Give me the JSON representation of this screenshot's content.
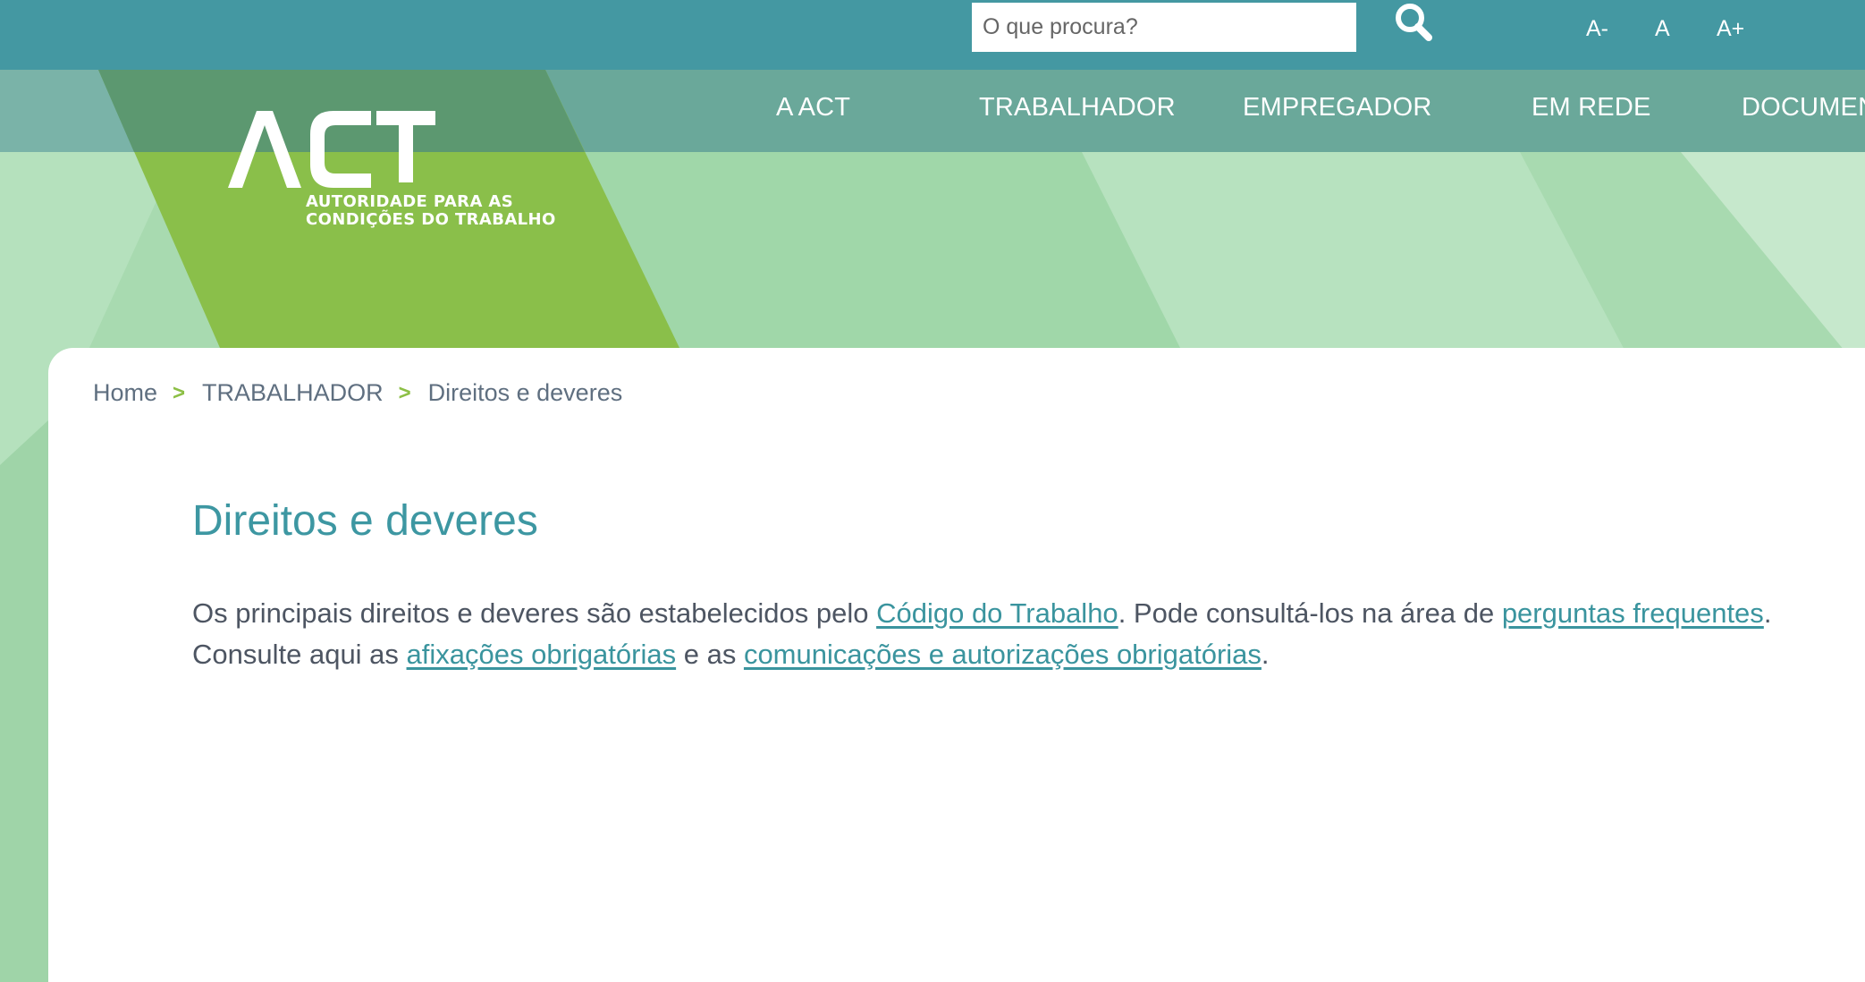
{
  "search": {
    "placeholder": "O que procura?",
    "value": ""
  },
  "font_controls": {
    "decrease": "A-",
    "normal": "A",
    "increase": "A+"
  },
  "nav": {
    "items": [
      {
        "label": "A ACT"
      },
      {
        "label": "TRABALHADOR"
      },
      {
        "label": "EMPREGADOR"
      },
      {
        "label": "EM REDE"
      },
      {
        "label": "DOCUMEN"
      }
    ]
  },
  "logo": {
    "text": "ACT",
    "subtitle_line1": "AUTORIDADE PARA AS",
    "subtitle_line2": "CONDIÇÕES DO TRABALHO"
  },
  "breadcrumb": {
    "items": [
      {
        "label": "Home"
      },
      {
        "label": "TRABALHADOR"
      },
      {
        "label": "Direitos e deveres"
      }
    ],
    "separator": ">"
  },
  "page": {
    "title": "Direitos e deveres",
    "paragraph": {
      "t1": "Os principais direitos e deveres são estabelecidos pelo ",
      "link1": "Código do Trabalho",
      "t2": ". Pode consultá-los na área de ",
      "link2": "perguntas frequentes",
      "t3": ". Consulte aqui as ",
      "link3": "afixações obrigatórias",
      "t4": " e as ",
      "link4": "comunicações e autorizações obrigatórias",
      "t5": "."
    }
  },
  "colors": {
    "topbar": "#4498a2",
    "nav_band": "#6aa89a",
    "light_green": "#a8dab0",
    "logo_green": "#8abf4a",
    "title_teal": "#3d97a2",
    "link_teal": "#3a949e",
    "breadcrumb_separator": "#8cbf45",
    "body_text": "#4d5562"
  }
}
